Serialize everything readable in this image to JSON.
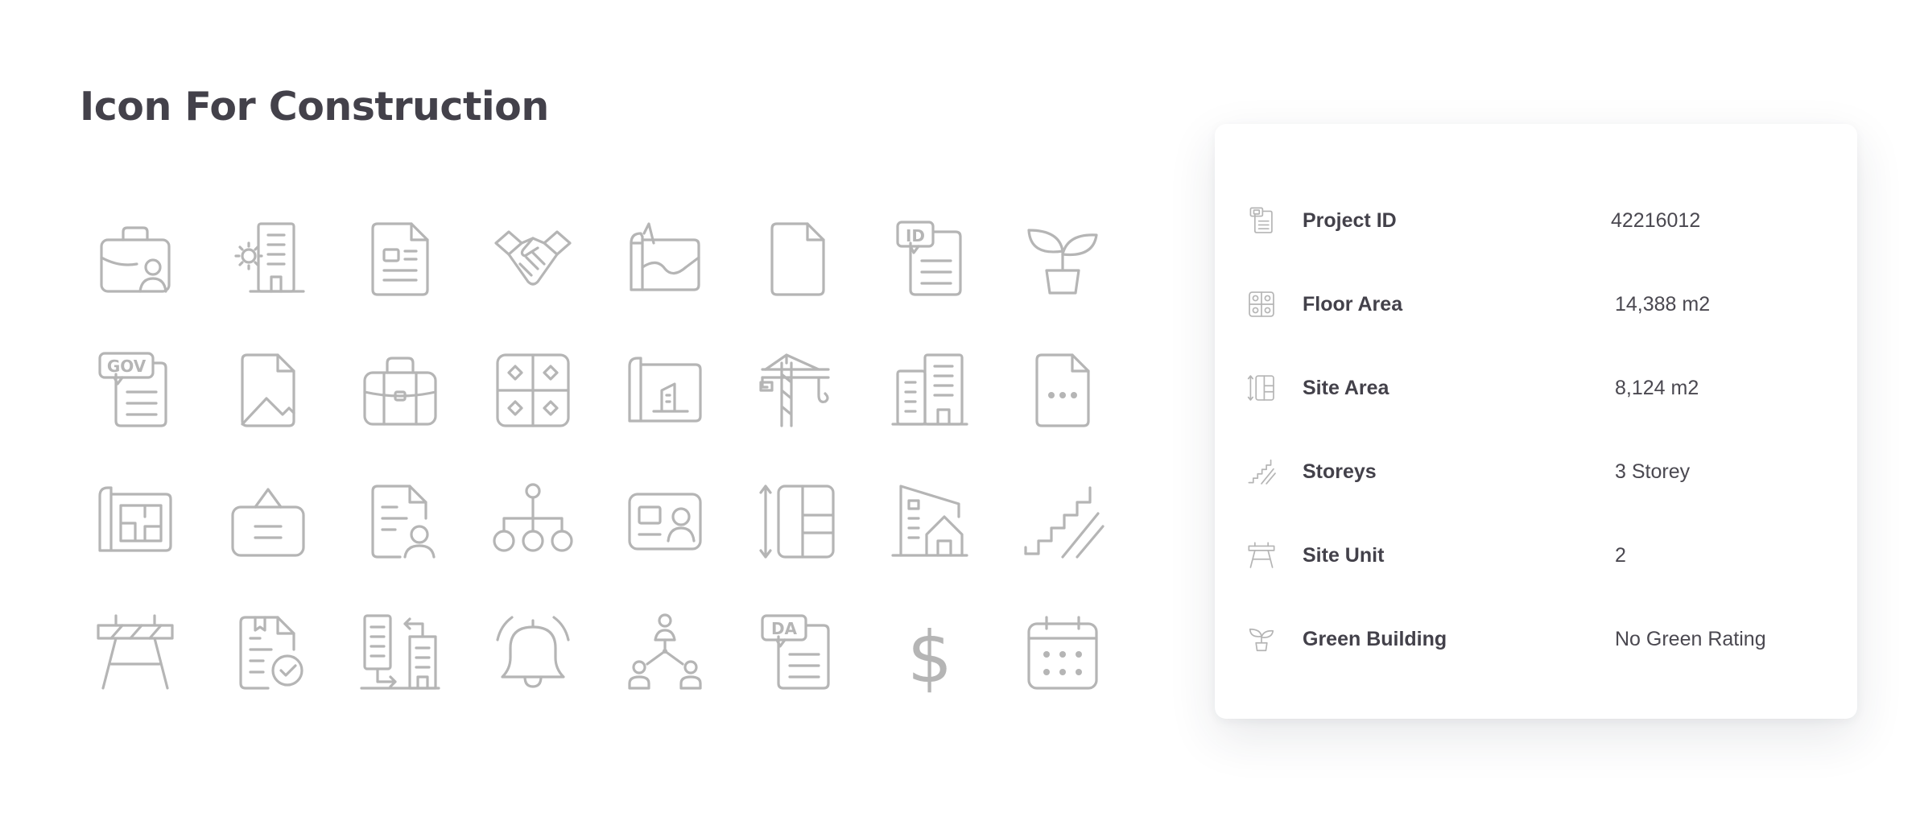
{
  "title": "Icon For Construction",
  "colors": {
    "icon": "#b5b5b5",
    "text": "#43414a",
    "card_bg": "#ffffff"
  },
  "icon_grid": [
    [
      "briefcase-user-icon",
      "building-gear-icon",
      "document-icon",
      "handshake-icon",
      "map-icon",
      "file-icon",
      "id-document-icon",
      "plant-icon"
    ],
    [
      "gov-document-icon",
      "image-file-icon",
      "briefcase-icon",
      "floor-plan-grid-icon",
      "blueprint-icon",
      "crane-icon",
      "office-building-icon",
      "file-more-icon"
    ],
    [
      "floor-plan-icon",
      "signboard-icon",
      "document-user-icon",
      "hierarchy-icon",
      "contact-card-icon",
      "site-area-icon",
      "house-building-icon",
      "stairs-icon"
    ],
    [
      "barrier-icon",
      "document-check-icon",
      "building-transfer-icon",
      "bell-icon",
      "organization-chart-icon",
      "da-document-icon",
      "dollar-icon",
      "calendar-icon"
    ]
  ],
  "gov_badge": "GOV",
  "id_badge": "ID",
  "da_badge": "DA",
  "dollar_symbol": "$",
  "project_details": [
    {
      "icon": "id-document-icon",
      "label": "Project ID",
      "value": "42216012"
    },
    {
      "icon": "floor-plan-grid-icon",
      "label": "Floor Area",
      "value": "14,388 m2"
    },
    {
      "icon": "site-area-icon",
      "label": "Site Area",
      "value": "8,124 m2"
    },
    {
      "icon": "stairs-icon",
      "label": "Storeys",
      "value": "3 Storey"
    },
    {
      "icon": "barrier-icon",
      "label": "Site Unit",
      "value": "2"
    },
    {
      "icon": "plant-icon",
      "label": "Green Building",
      "value": "No Green Rating"
    }
  ]
}
